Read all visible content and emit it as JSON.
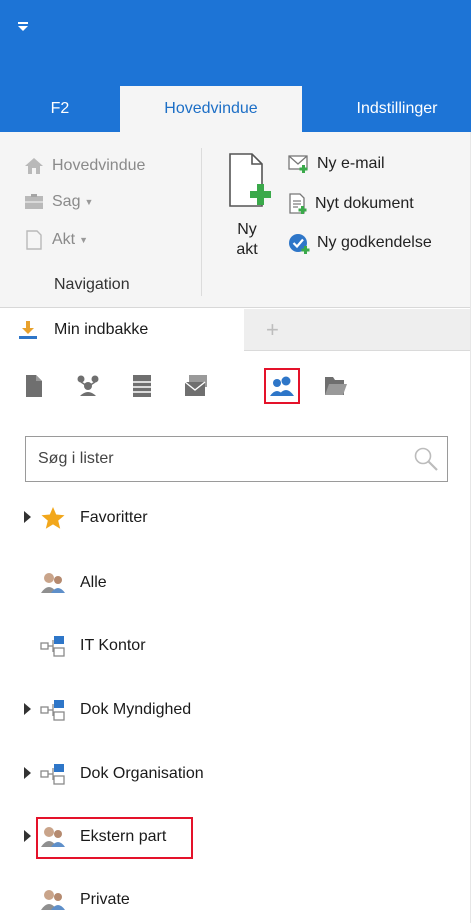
{
  "tabs": {
    "f2": "F2",
    "hovedvindue": "Hovedvindue",
    "indstillinger": "Indstillinger"
  },
  "ribbon": {
    "navigation": {
      "home": "Hovedvindue",
      "sag": "Sag",
      "akt": "Akt",
      "group_label": "Navigation"
    },
    "new_akt": {
      "line1": "Ny",
      "line2": "akt"
    },
    "commands": {
      "ny_email": "Ny e-mail",
      "nyt_dokument": "Nyt dokument",
      "ny_godkendelse": "Ny godkendelse"
    }
  },
  "doc_tab": {
    "label": "Min indbakke"
  },
  "search": {
    "placeholder": "Søg i lister"
  },
  "list": {
    "favoritter": "Favoritter",
    "alle": "Alle",
    "it_kontor": "IT Kontor",
    "dok_myndighed": "Dok Myndighed",
    "dok_organisation": "Dok Organisation",
    "ekstern_part": "Ekstern part",
    "private": "Private"
  },
  "colors": {
    "accent": "#1d74d6",
    "highlight": "#e4122a",
    "star": "#f2a71b",
    "icon_gray": "#6f6f6f"
  },
  "icons": {
    "toolbar": [
      "document-icon",
      "org-chart-icon",
      "list-icon",
      "mail-stack-icon",
      "contacts-icon",
      "folder-open-icon"
    ]
  }
}
